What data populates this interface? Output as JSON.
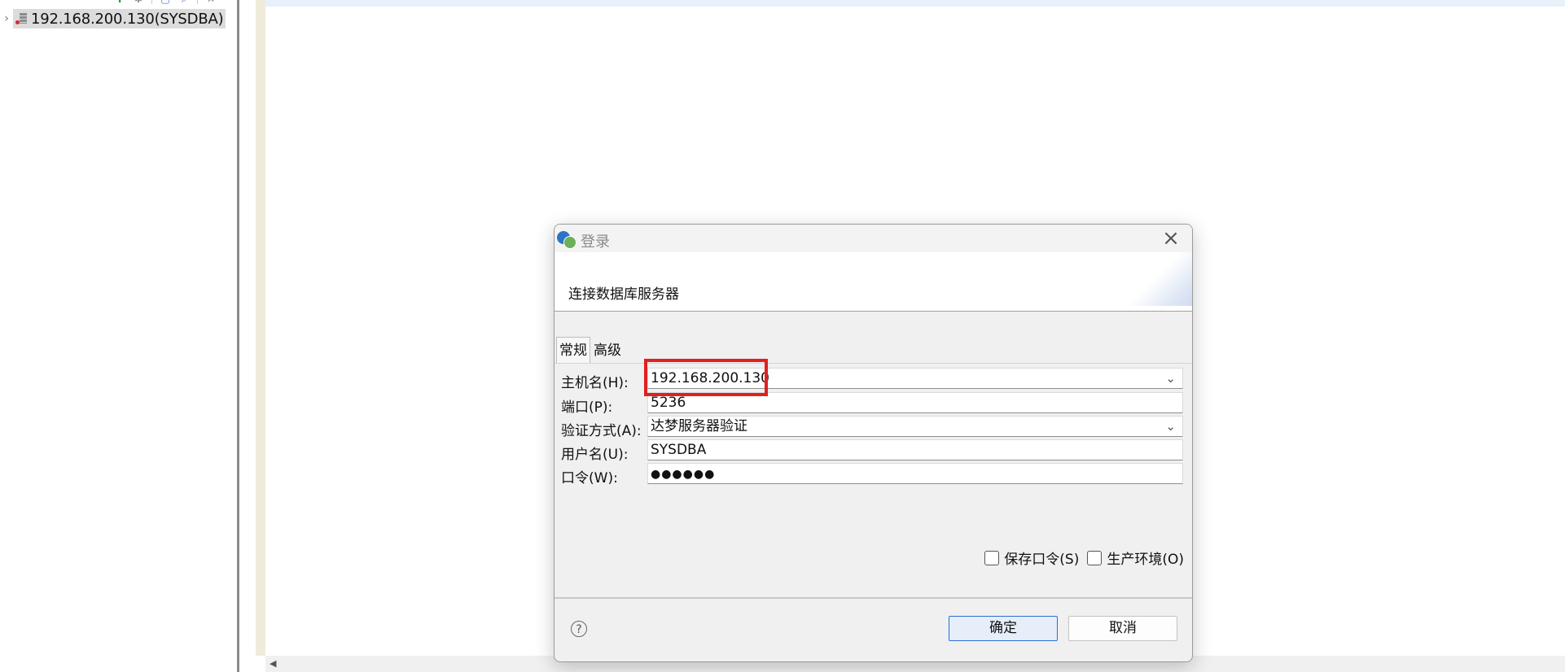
{
  "tree": {
    "root_label": "192.168.200.130(SYSDBA)"
  },
  "dialog": {
    "title": "登录",
    "banner": "连接数据库服务器",
    "tabs": [
      {
        "label": "常规",
        "active": true
      },
      {
        "label": "高级",
        "active": false
      }
    ],
    "fields": {
      "host": {
        "label": "主机名(H):",
        "value": "192.168.200.130"
      },
      "port": {
        "label": "端口(P):",
        "value": "5236"
      },
      "auth": {
        "label": "验证方式(A):",
        "value": "达梦服务器验证"
      },
      "user": {
        "label": "用户名(U):",
        "value": "SYSDBA"
      },
      "password": {
        "label": "口令(W):",
        "value": "●●●●●●"
      }
    },
    "options": {
      "save_password": {
        "label": "保存口令(S)",
        "checked": false
      },
      "production_env": {
        "label": "生产环境(O)",
        "checked": false
      }
    },
    "buttons": {
      "ok": "确定",
      "cancel": "取消",
      "help": "?"
    }
  },
  "colors": {
    "highlight": "#e02020",
    "ok_border": "#2a6fd6"
  }
}
